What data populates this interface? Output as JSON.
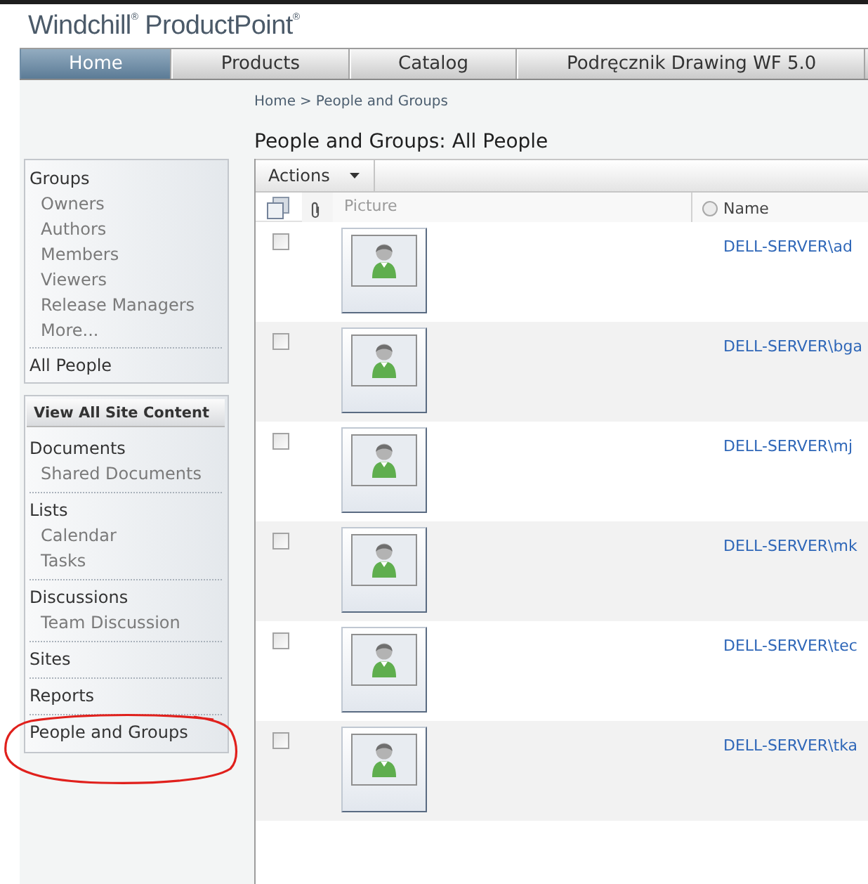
{
  "logo": "Windchill$^{®}$ ProductPoint$^{®}$",
  "tabs": [
    {
      "label": "Home",
      "selected": true
    },
    {
      "label": "Products",
      "selected": false
    },
    {
      "label": "Catalog",
      "selected": false
    },
    {
      "label": "Podręcznik Drawing WF 5.0",
      "selected": false
    }
  ],
  "breadcrumb": {
    "items": [
      "Home",
      "People and Groups"
    ],
    "separator": ">"
  },
  "page_title": "People and Groups: All People",
  "groups_panel": {
    "heading": "Groups",
    "items": [
      "Owners",
      "Authors",
      "Members",
      "Viewers",
      "Release Managers",
      "More..."
    ],
    "footer": "All People"
  },
  "site_panel": {
    "header": "View All Site Content",
    "sections": [
      {
        "heading": "Documents",
        "items": [
          "Shared Documents"
        ],
        "circled": false
      },
      {
        "heading": "Lists",
        "items": [
          "Calendar",
          "Tasks"
        ],
        "circled": false
      },
      {
        "heading": "Discussions",
        "items": [
          "Team Discussion"
        ],
        "circled": false
      },
      {
        "heading": "Sites",
        "circled": false
      },
      {
        "heading": "Reports",
        "circled": false
      },
      {
        "heading": "People and Groups",
        "circled": true
      }
    ]
  },
  "toolbar": {
    "actions": "Actions"
  },
  "table": {
    "columns": [
      "Picture",
      "Name"
    ],
    "rows": [
      {
        "checked": false,
        "name": "DELL-SERVER\\ad"
      },
      {
        "checked": false,
        "name": "DELL-SERVER\\bga"
      },
      {
        "checked": false,
        "name": "DELL-SERVER\\mj"
      },
      {
        "checked": false,
        "name": "DELL-SERVER\\mk"
      },
      {
        "checked": false,
        "name": "DELL-SERVER\\tec"
      },
      {
        "checked": false,
        "name": "DELL-SERVER\\tka"
      }
    ]
  }
}
